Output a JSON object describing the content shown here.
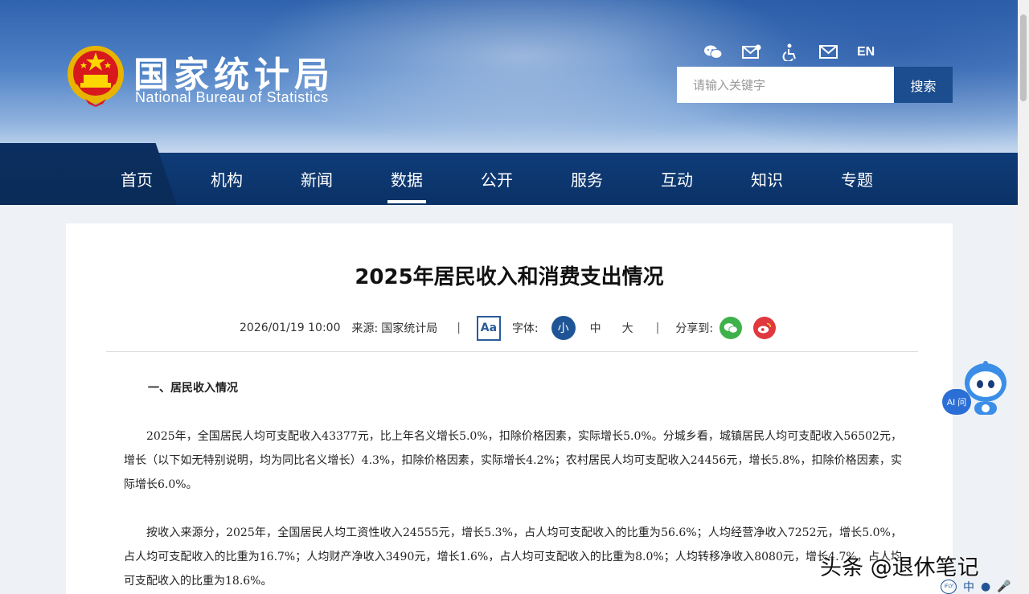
{
  "header": {
    "site_name_cn": "国家统计局",
    "site_name_en": "National Bureau of Statistics",
    "lang_switch": "EN",
    "search": {
      "placeholder": "请输入关键字",
      "button_label": "搜索"
    },
    "icons": [
      "wechat-icon",
      "mail-subscribe-icon",
      "accessibility-icon",
      "email-icon"
    ]
  },
  "nav": {
    "items": [
      {
        "label": "首页"
      },
      {
        "label": "机构"
      },
      {
        "label": "新闻"
      },
      {
        "label": "数据",
        "active": true
      },
      {
        "label": "公开"
      },
      {
        "label": "服务"
      },
      {
        "label": "互动"
      },
      {
        "label": "知识"
      },
      {
        "label": "专题"
      }
    ]
  },
  "article": {
    "title": "2025年居民收入和消费支出情况",
    "date": "2026/01/19 10:00",
    "source_label": "来源:",
    "source": "国家统计局",
    "font_label": "字体:",
    "font_sizes": [
      "小",
      "中",
      "大"
    ],
    "font_size_active": "小",
    "share_label": "分享到:",
    "aa_label": "Aa",
    "section_heading": "一、居民收入情况",
    "paragraphs": [
      "2025年，全国居民人均可支配收入43377元，比上年名义增长5.0%，扣除价格因素，实际增长5.0%。分城乡看，城镇居民人均可支配收入56502元，增长（以下如无特别说明，均为同比名义增长）4.3%，扣除价格因素，实际增长4.2%；农村居民人均可支配收入24456元，增长5.8%，扣除价格因素，实际增长6.0%。",
      "按收入来源分，2025年，全国居民人均工资性收入24555元，增长5.3%，占人均可支配收入的比重为56.6%；人均经营净收入7252元，增长5.0%，占人均可支配收入的比重为16.7%；人均财产净收入3490元，增长1.6%，占人均可支配收入的比重为8.0%；人均转移净收入8080元，增长4.7%，占人均可支配收入的比重为18.6%。"
    ]
  },
  "ai_assistant": {
    "label": "AI 问"
  },
  "watermark": "头条 @退休笔记",
  "bottom_toolbar": {
    "ifly": "iFLY",
    "lang": "中"
  },
  "colors": {
    "nav_bg": "#0f3c78",
    "search_button": "#1b4d8f",
    "active_font_size": "#1f5596",
    "wechat_share": "#3fb14a",
    "weibo_share": "#e0383e"
  }
}
